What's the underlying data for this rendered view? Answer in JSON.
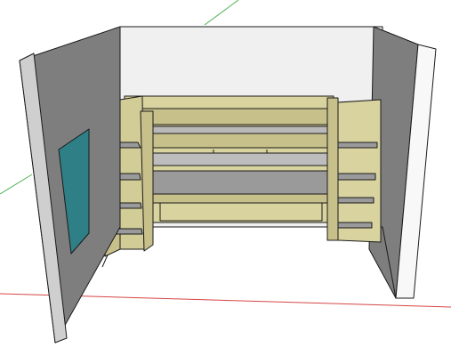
{
  "viewport": {
    "mode": "3d-model-view",
    "background_color": "#ffffff",
    "axis_colors": {
      "x": "#d64545",
      "y": "#4caf50",
      "z": "#3b5bdb"
    },
    "axes_visible": [
      "x",
      "y"
    ]
  },
  "model": {
    "subject": "room-with-bunk-shelving",
    "colors": {
      "wall": "#7e7e7e",
      "wall_light": "#cfcfcf",
      "wall_edge": "#f2f2f2",
      "wood": "#c8c08a",
      "wood_dark": "#8f875a",
      "shelf": "#9a9a9a",
      "shelf_light": "#b9b9b9",
      "poster": "#2f7f86",
      "line": "#1a1a1a"
    }
  }
}
